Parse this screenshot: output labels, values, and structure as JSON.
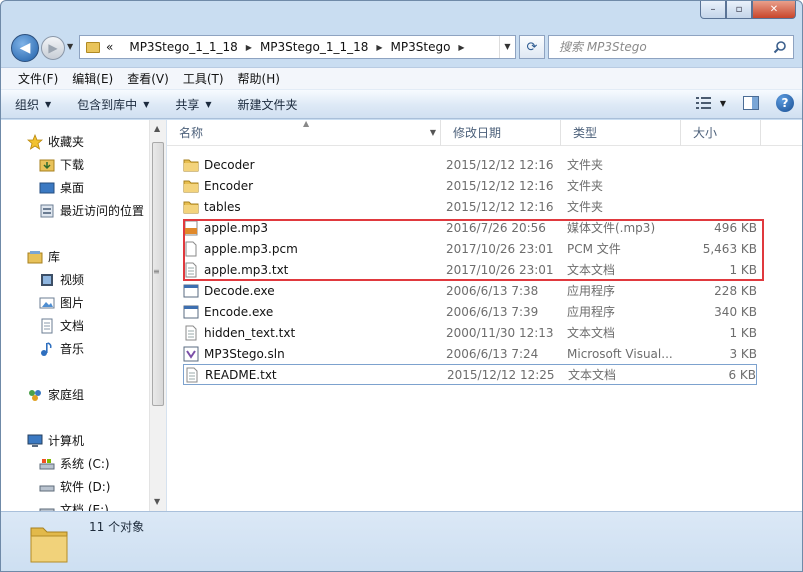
{
  "window": {
    "min_glyph": "–",
    "max_glyph": "▫",
    "close_glyph": "✕"
  },
  "address": {
    "prefix": "«",
    "crumbs": [
      "MP3Stego_1_1_18",
      "MP3Stego_1_1_18",
      "MP3Stego"
    ],
    "search_placeholder": "搜索 MP3Stego"
  },
  "menu": [
    "文件(F)",
    "编辑(E)",
    "查看(V)",
    "工具(T)",
    "帮助(H)"
  ],
  "toolbar": {
    "organize": "组织",
    "include_library": "包含到库中",
    "share": "共享",
    "new_folder": "新建文件夹",
    "help": "?"
  },
  "nav": {
    "favorites": "收藏夹",
    "downloads": "下载",
    "desktop": "桌面",
    "recent": "最近访问的位置",
    "libraries": "库",
    "videos": "视频",
    "pictures": "图片",
    "documents": "文档",
    "music": "音乐",
    "homegroup": "家庭组",
    "computer": "计算机",
    "drive_c": "系统 (C:)",
    "drive_d": "软件 (D:)",
    "drive_e": "文档 (E:)"
  },
  "columns": {
    "name": "名称",
    "date": "修改日期",
    "type": "类型",
    "size": "大小"
  },
  "files": [
    {
      "name": "Decoder",
      "date": "2015/12/12 12:16",
      "type": "文件夹",
      "size": "",
      "icon": "folder-icon"
    },
    {
      "name": "Encoder",
      "date": "2015/12/12 12:16",
      "type": "文件夹",
      "size": "",
      "icon": "folder-icon"
    },
    {
      "name": "tables",
      "date": "2015/12/12 12:16",
      "type": "文件夹",
      "size": "",
      "icon": "folder-icon"
    },
    {
      "name": "apple.mp3",
      "date": "2016/7/26 20:56",
      "type": "媒体文件(.mp3)",
      "size": "496 KB",
      "icon": "mp3-file-icon"
    },
    {
      "name": "apple.mp3.pcm",
      "date": "2017/10/26 23:01",
      "type": "PCM 文件",
      "size": "5,463 KB",
      "icon": "blank-file-icon"
    },
    {
      "name": "apple.mp3.txt",
      "date": "2017/10/26 23:01",
      "type": "文本文档",
      "size": "1 KB",
      "icon": "text-file-icon"
    },
    {
      "name": "Decode.exe",
      "date": "2006/6/13 7:38",
      "type": "应用程序",
      "size": "228 KB",
      "icon": "exe-icon"
    },
    {
      "name": "Encode.exe",
      "date": "2006/6/13 7:39",
      "type": "应用程序",
      "size": "340 KB",
      "icon": "exe-icon"
    },
    {
      "name": "hidden_text.txt",
      "date": "2000/11/30 12:13",
      "type": "文本文档",
      "size": "1 KB",
      "icon": "text-file-icon"
    },
    {
      "name": "MP3Stego.sln",
      "date": "2006/6/13 7:24",
      "type": "Microsoft Visual...",
      "size": "3 KB",
      "icon": "sln-file-icon"
    },
    {
      "name": "README.txt",
      "date": "2015/12/12 12:25",
      "type": "文本文档",
      "size": "6 KB",
      "icon": "text-file-icon"
    }
  ],
  "status": {
    "count": "11 个对象"
  }
}
